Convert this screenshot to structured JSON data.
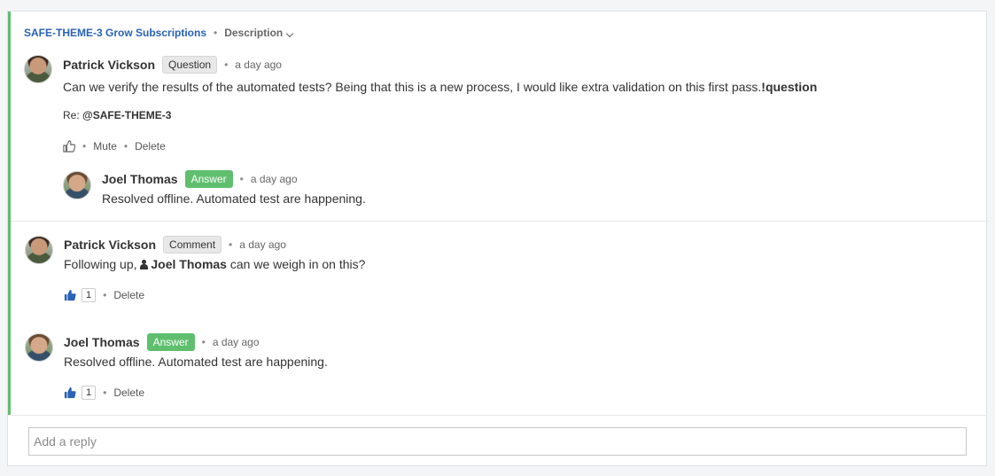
{
  "breadcrumb": {
    "issue": "SAFE-THEME-3 Grow Subscriptions",
    "separator": "•",
    "section": "Description"
  },
  "comments": [
    {
      "author": "Patrick Vickson",
      "badge": "Question",
      "time": "a day ago",
      "text": "Can we verify the results of the automated tests? Being that this is a new process, I would like extra validation on this first pass.",
      "tag": "!question",
      "re_label": "Re:",
      "re_target": "@SAFE-THEME-3",
      "actions": {
        "mute": "Mute",
        "delete": "Delete"
      },
      "reply": {
        "author": "Joel Thomas",
        "badge": "Answer",
        "time": "a day ago",
        "text": "Resolved offline. Automated test are happening."
      }
    },
    {
      "author": "Patrick Vickson",
      "badge": "Comment",
      "time": "a day ago",
      "text_before": "Following up,",
      "mention": "Joel Thomas",
      "text_after": "can we weigh in on this?",
      "likes": "1",
      "actions": {
        "delete": "Delete"
      }
    },
    {
      "author": "Joel Thomas",
      "badge": "Answer",
      "time": "a day ago",
      "text": "Resolved offline. Automated test are happening.",
      "likes": "1",
      "actions": {
        "delete": "Delete"
      }
    }
  ],
  "dot": "•",
  "reply_input": {
    "placeholder": "Add a reply"
  },
  "colors": {
    "accent": "#2a62b6",
    "answer": "#5fbf6e",
    "thread_bar": "#5fbf6e"
  }
}
